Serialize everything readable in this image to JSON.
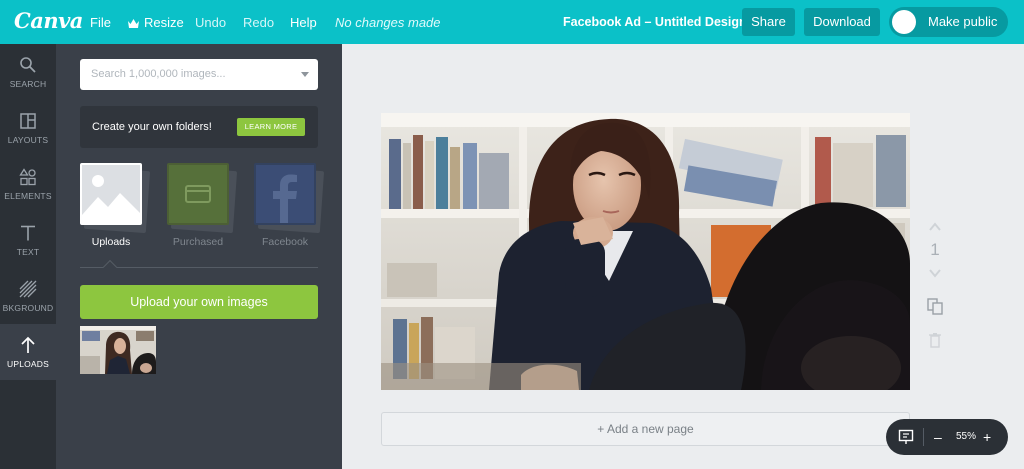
{
  "topbar": {
    "logo": "Canva",
    "menu": {
      "file": "File",
      "resize": "Resize",
      "undo": "Undo",
      "redo": "Redo",
      "help": "Help"
    },
    "status": "No changes made",
    "design_title": "Facebook Ad – Untitled Design",
    "share_label": "Share",
    "download_label": "Download",
    "make_public_label": "Make public",
    "accent_color": "#0bc1c8"
  },
  "rail": {
    "items": [
      {
        "label": "SEARCH",
        "icon": "search-icon"
      },
      {
        "label": "LAYOUTS",
        "icon": "layouts-icon"
      },
      {
        "label": "ELEMENTS",
        "icon": "elements-icon"
      },
      {
        "label": "TEXT",
        "icon": "text-icon"
      },
      {
        "label": "BKGROUND",
        "icon": "background-icon"
      },
      {
        "label": "UPLOADS",
        "icon": "upload-arrow-icon",
        "active": true
      }
    ]
  },
  "panel": {
    "search_placeholder": "Search 1,000,000 images...",
    "folders_text": "Create your own folders!",
    "learn_more": "LEARN MORE",
    "sources": [
      {
        "label": "Uploads",
        "active": true
      },
      {
        "label": "Purchased"
      },
      {
        "label": "Facebook"
      }
    ],
    "upload_button": "Upload your own images",
    "brand_green": "#8dc63f"
  },
  "page": {
    "number": "1",
    "add_page": "+ Add a new page"
  },
  "zoom": {
    "minus": "–",
    "value": "55%",
    "plus": "+"
  }
}
